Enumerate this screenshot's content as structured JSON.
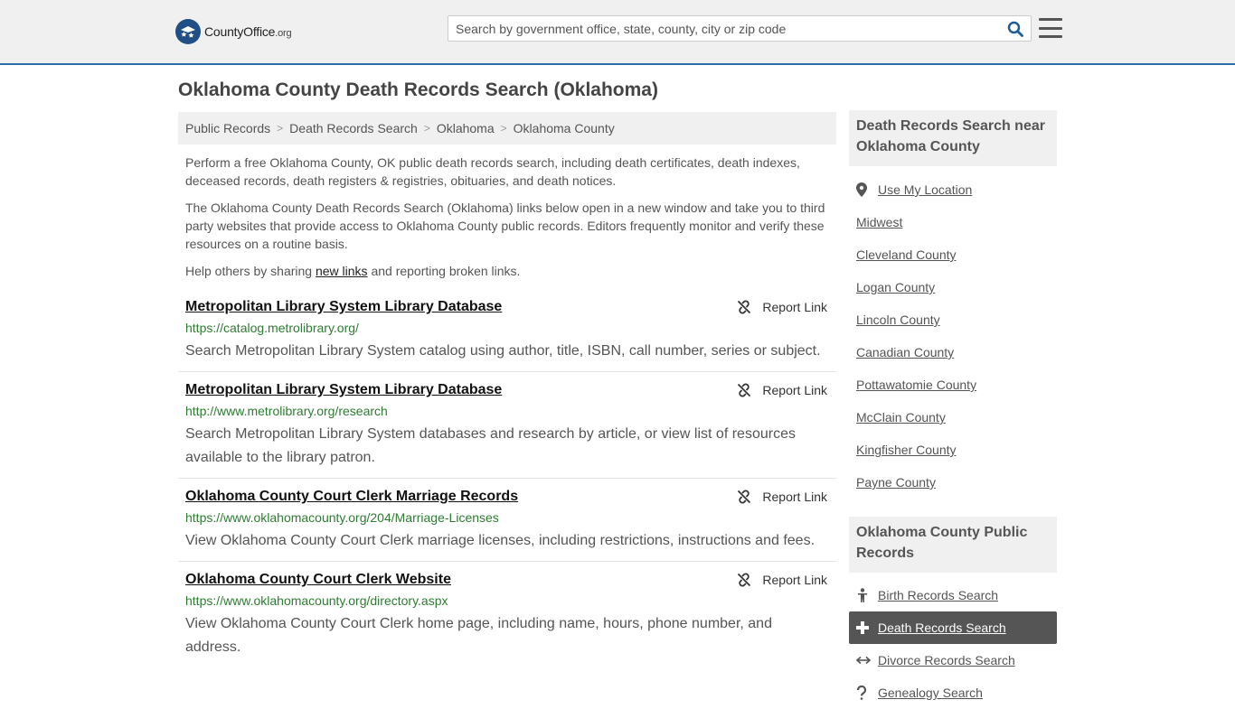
{
  "header": {
    "logo_name": "CountyOffice",
    "logo_tld": ".org",
    "search_placeholder": "Search by government office, state, county, city or zip code"
  },
  "page": {
    "title": "Oklahoma County Death Records Search (Oklahoma)"
  },
  "breadcrumb": [
    "Public Records",
    "Death Records Search",
    "Oklahoma",
    "Oklahoma County"
  ],
  "intro": {
    "p1": "Perform a free Oklahoma County, OK public death records search, including death certificates, death indexes, deceased records, death registers & registries, obituaries, and death notices.",
    "p2": "The Oklahoma County Death Records Search (Oklahoma) links below open in a new window and take you to third party websites that provide access to Oklahoma County public records. Editors frequently monitor and verify these resources on a routine basis.",
    "p3_before": "Help others by sharing ",
    "p3_link": "new links",
    "p3_after": " and reporting broken links."
  },
  "report_label": "Report Link",
  "results": [
    {
      "title": "Metropolitan Library System Library Database",
      "url": "https://catalog.metrolibrary.org/",
      "desc": "Search Metropolitan Library System catalog using author, title, ISBN, call number, series or subject."
    },
    {
      "title": "Metropolitan Library System Library Database",
      "url": "http://www.metrolibrary.org/research",
      "desc": "Search Metropolitan Library System databases and research by article, or view list of resources available to the library patron."
    },
    {
      "title": "Oklahoma County Court Clerk Marriage Records",
      "url": "https://www.oklahomacounty.org/204/Marriage-Licenses",
      "desc": "View Oklahoma County Court Clerk marriage licenses, including restrictions, instructions and fees."
    },
    {
      "title": "Oklahoma County Court Clerk Website",
      "url": "https://www.oklahomacounty.org/directory.aspx",
      "desc": "View Oklahoma County Court Clerk home page, including name, hours, phone number, and address."
    }
  ],
  "sidebar": {
    "nearby_title": "Death Records Search near Oklahoma County",
    "use_location": "Use My Location",
    "nearby": [
      "Midwest",
      "Cleveland County",
      "Logan County",
      "Lincoln County",
      "Canadian County",
      "Pottawatomie County",
      "McClain County",
      "Kingfisher County",
      "Payne County"
    ],
    "public_title": "Oklahoma County Public Records",
    "public_links": [
      {
        "label": "Birth Records Search",
        "icon": "baby-icon",
        "active": false
      },
      {
        "label": "Death Records Search",
        "icon": "cross-icon",
        "active": true
      },
      {
        "label": "Divorce Records Search",
        "icon": "arrows-icon",
        "active": false
      },
      {
        "label": "Genealogy Search",
        "icon": "question-icon",
        "active": false
      }
    ]
  },
  "colors": {
    "header_bg": "#f0f0f0",
    "header_border": "#2b6ea9",
    "url_green": "#2e7d32",
    "active_bg": "#555555"
  }
}
